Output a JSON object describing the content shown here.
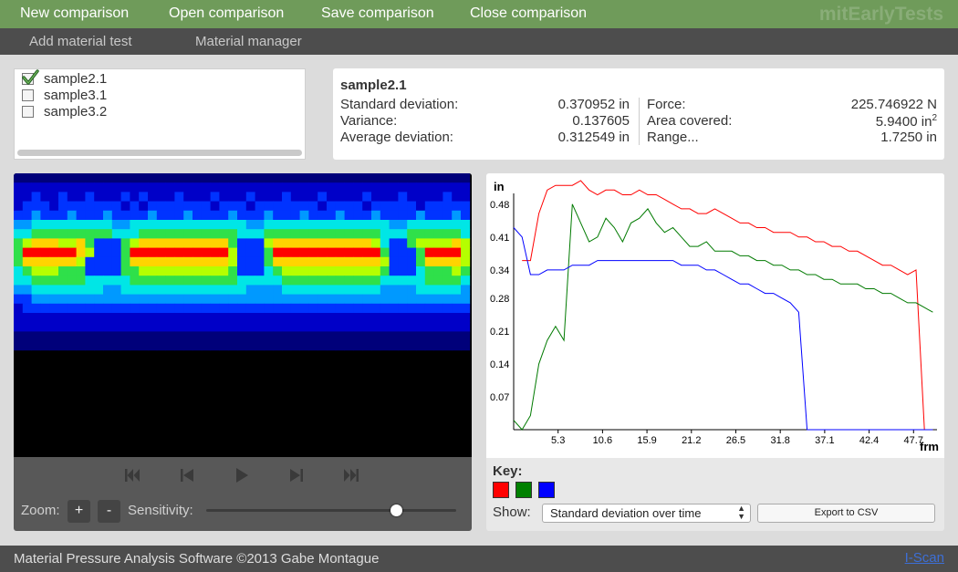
{
  "menu": {
    "items": [
      "New comparison",
      "Open comparison",
      "Save comparison",
      "Close comparison"
    ],
    "brand": "mitEarlyTests"
  },
  "submenu": {
    "items": [
      "Add material test",
      "Material manager"
    ]
  },
  "samples": [
    {
      "label": "sample2.1",
      "checked": true
    },
    {
      "label": "sample3.1",
      "checked": false
    },
    {
      "label": "sample3.2",
      "checked": false
    }
  ],
  "stats": {
    "title": "sample2.1",
    "left": [
      {
        "label": "Standard deviation:",
        "value": "0.370952 in"
      },
      {
        "label": "Variance:",
        "value": "0.137605"
      },
      {
        "label": "Average deviation:",
        "value": "0.312549 in"
      }
    ],
    "right": [
      {
        "label": "Force:",
        "value": "225.746922 N"
      },
      {
        "label": "Area covered:",
        "value": "5.9400 in",
        "sup": "2"
      },
      {
        "label": "Range...",
        "value": "1.7250 in"
      }
    ]
  },
  "heatmap": {
    "rows": [
      "000000000000000000000000000000000000000000000000000",
      "111111111111111111111111111111111111111111111111111",
      "112112112111212111211121112111211121111211121111211",
      "122212222222121222222212221222222212222122222122222",
      "223222322232222322232222322232223222322232222322232",
      "334444444443344444444444443344444444444444334444444",
      "445555555554445555555555544455555555555554445555554",
      "567776675222567777777777522267777777777764225666676",
      "588888876222588888888888622258888888888885222588886",
      "577777762222577777777777622257777777777776222577776",
      "456665552222556666666666522245666666666665222455565",
      "445555554444455555555555544444555555555554444455554",
      "334444444433444444444444443333444444444443333444443",
      "223333333333333333333333333333333333333333333333333",
      "122222222222222222222222222222222222222222222222222",
      "111111111111111111111111111111111111111111111111111",
      "111111111111111111111111111111111111111111111111111",
      "000000000000000000000000000000000000000000000000000",
      "000000000000000000000000000000000000000000000000000"
    ],
    "colors": [
      "#00007a",
      "#0000c8",
      "#0033ff",
      "#0099ff",
      "#00e6e6",
      "#2fe04a",
      "#b5ff00",
      "#ffd400",
      "#ff0000"
    ]
  },
  "controls": {
    "zoom_label": "Zoom:",
    "zoom_in": "+",
    "zoom_out": "-",
    "sensitivity_label": "Sensitivity:",
    "sensitivity_value": 0.76
  },
  "chart_data": {
    "type": "line",
    "ylabel": "in",
    "xlabel": "frm",
    "ylim": [
      0,
      0.53
    ],
    "xlim": [
      0,
      50.5
    ],
    "y_ticks": [
      0.07,
      0.14,
      0.21,
      0.28,
      0.34,
      0.41,
      0.48
    ],
    "x_ticks": [
      "5.3",
      "10.6",
      "15.9",
      "21.2",
      "26.5",
      "31.8",
      "37.1",
      "42.4",
      "47.7"
    ],
    "series": [
      {
        "color": "#ff0000",
        "points": [
          [
            1,
            0.36
          ],
          [
            2,
            0.36
          ],
          [
            3,
            0.46
          ],
          [
            4,
            0.51
          ],
          [
            5,
            0.52
          ],
          [
            6,
            0.52
          ],
          [
            7,
            0.52
          ],
          [
            8,
            0.53
          ],
          [
            9,
            0.51
          ],
          [
            10,
            0.5
          ],
          [
            11,
            0.51
          ],
          [
            12,
            0.51
          ],
          [
            13,
            0.5
          ],
          [
            14,
            0.5
          ],
          [
            15,
            0.51
          ],
          [
            16,
            0.5
          ],
          [
            17,
            0.5
          ],
          [
            18,
            0.49
          ],
          [
            19,
            0.48
          ],
          [
            20,
            0.47
          ],
          [
            21,
            0.47
          ],
          [
            22,
            0.46
          ],
          [
            23,
            0.46
          ],
          [
            24,
            0.47
          ],
          [
            25,
            0.46
          ],
          [
            26,
            0.45
          ],
          [
            27,
            0.44
          ],
          [
            28,
            0.44
          ],
          [
            29,
            0.43
          ],
          [
            30,
            0.43
          ],
          [
            31,
            0.42
          ],
          [
            32,
            0.42
          ],
          [
            33,
            0.42
          ],
          [
            34,
            0.41
          ],
          [
            35,
            0.41
          ],
          [
            36,
            0.4
          ],
          [
            37,
            0.4
          ],
          [
            38,
            0.39
          ],
          [
            39,
            0.39
          ],
          [
            40,
            0.38
          ],
          [
            41,
            0.38
          ],
          [
            42,
            0.37
          ],
          [
            43,
            0.36
          ],
          [
            44,
            0.35
          ],
          [
            45,
            0.35
          ],
          [
            46,
            0.34
          ],
          [
            47,
            0.33
          ],
          [
            48,
            0.34
          ],
          [
            49,
            0.0
          ],
          [
            50,
            0.0
          ]
        ]
      },
      {
        "color": "#007a00",
        "points": [
          [
            0,
            0.02
          ],
          [
            1,
            0.0
          ],
          [
            2,
            0.03
          ],
          [
            3,
            0.14
          ],
          [
            4,
            0.19
          ],
          [
            5,
            0.22
          ],
          [
            6,
            0.19
          ],
          [
            7,
            0.48
          ],
          [
            8,
            0.44
          ],
          [
            9,
            0.4
          ],
          [
            10,
            0.41
          ],
          [
            11,
            0.45
          ],
          [
            12,
            0.43
          ],
          [
            13,
            0.4
          ],
          [
            14,
            0.44
          ],
          [
            15,
            0.45
          ],
          [
            16,
            0.47
          ],
          [
            17,
            0.44
          ],
          [
            18,
            0.42
          ],
          [
            19,
            0.43
          ],
          [
            20,
            0.41
          ],
          [
            21,
            0.39
          ],
          [
            22,
            0.39
          ],
          [
            23,
            0.4
          ],
          [
            24,
            0.38
          ],
          [
            25,
            0.38
          ],
          [
            26,
            0.38
          ],
          [
            27,
            0.37
          ],
          [
            28,
            0.37
          ],
          [
            29,
            0.36
          ],
          [
            30,
            0.36
          ],
          [
            31,
            0.35
          ],
          [
            32,
            0.35
          ],
          [
            33,
            0.34
          ],
          [
            34,
            0.34
          ],
          [
            35,
            0.33
          ],
          [
            36,
            0.33
          ],
          [
            37,
            0.32
          ],
          [
            38,
            0.32
          ],
          [
            39,
            0.31
          ],
          [
            40,
            0.31
          ],
          [
            41,
            0.31
          ],
          [
            42,
            0.3
          ],
          [
            43,
            0.3
          ],
          [
            44,
            0.29
          ],
          [
            45,
            0.29
          ],
          [
            46,
            0.28
          ],
          [
            47,
            0.27
          ],
          [
            48,
            0.27
          ],
          [
            49,
            0.26
          ],
          [
            50,
            0.25
          ]
        ]
      },
      {
        "color": "#0000ff",
        "points": [
          [
            0,
            0.43
          ],
          [
            1,
            0.41
          ],
          [
            2,
            0.33
          ],
          [
            3,
            0.33
          ],
          [
            4,
            0.34
          ],
          [
            5,
            0.34
          ],
          [
            6,
            0.34
          ],
          [
            7,
            0.35
          ],
          [
            8,
            0.35
          ],
          [
            9,
            0.35
          ],
          [
            10,
            0.36
          ],
          [
            11,
            0.36
          ],
          [
            12,
            0.36
          ],
          [
            13,
            0.36
          ],
          [
            14,
            0.36
          ],
          [
            15,
            0.36
          ],
          [
            16,
            0.36
          ],
          [
            17,
            0.36
          ],
          [
            18,
            0.36
          ],
          [
            19,
            0.36
          ],
          [
            20,
            0.35
          ],
          [
            21,
            0.35
          ],
          [
            22,
            0.35
          ],
          [
            23,
            0.34
          ],
          [
            24,
            0.34
          ],
          [
            25,
            0.33
          ],
          [
            26,
            0.32
          ],
          [
            27,
            0.31
          ],
          [
            28,
            0.31
          ],
          [
            29,
            0.3
          ],
          [
            30,
            0.29
          ],
          [
            31,
            0.29
          ],
          [
            32,
            0.28
          ],
          [
            33,
            0.27
          ],
          [
            34,
            0.25
          ],
          [
            35,
            0.0
          ],
          [
            36,
            0.0
          ],
          [
            37,
            0.0
          ],
          [
            38,
            0.0
          ],
          [
            39,
            0.0
          ],
          [
            40,
            0.0
          ],
          [
            41,
            0.0
          ],
          [
            42,
            0.0
          ],
          [
            43,
            0.0
          ],
          [
            44,
            0.0
          ],
          [
            45,
            0.0
          ],
          [
            46,
            0.0
          ],
          [
            47,
            0.0
          ],
          [
            48,
            0.0
          ],
          [
            49,
            0.0
          ],
          [
            50,
            0.0
          ]
        ]
      }
    ]
  },
  "key": {
    "label": "Key:",
    "colors": [
      "#ff0000",
      "#008000",
      "#0000ff"
    ]
  },
  "show": {
    "label": "Show:",
    "selected": "Standard deviation over time"
  },
  "export_label": "Export to CSV",
  "footer": {
    "copyright": "Material Pressure Analysis Software ©2013 Gabe Montague",
    "link": "I-Scan"
  }
}
